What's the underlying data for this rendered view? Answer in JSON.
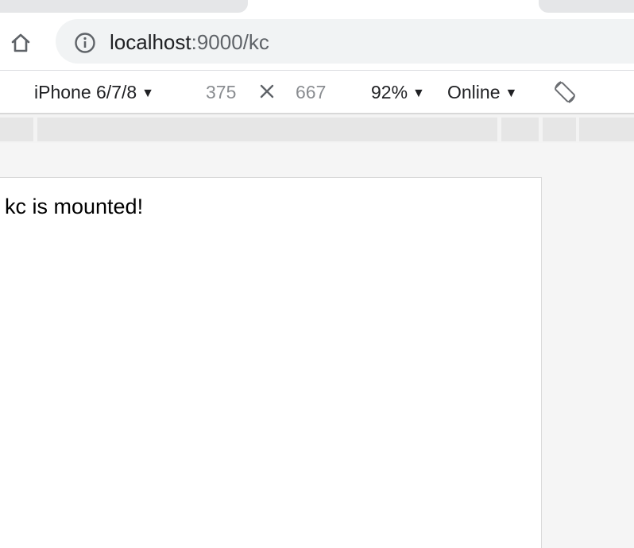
{
  "browser": {
    "url_host": "localhost",
    "url_path": ":9000/kc"
  },
  "device_toolbar": {
    "device": "iPhone 6/7/8",
    "width": "375",
    "separator": "×",
    "height": "667",
    "zoom": "92%",
    "network": "Online",
    "caret": "▼"
  },
  "page": {
    "text": "kc is mounted!"
  }
}
